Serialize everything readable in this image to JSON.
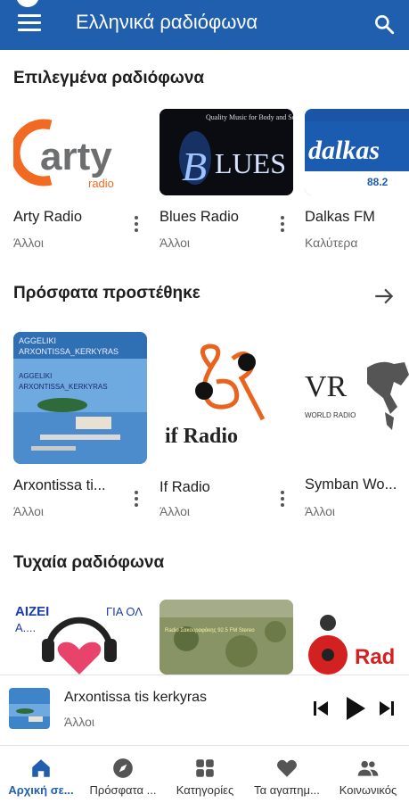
{
  "appbar": {
    "title": "Ελληνικά ραδιόφωνα"
  },
  "sections": {
    "featured": {
      "title": "Επιλεγμένα ραδιόφωνα",
      "items": [
        {
          "name": "Arty Radio",
          "category": "Άλλοι",
          "logo_text": "arty",
          "logo_sub": "radio"
        },
        {
          "name": "Blues Radio",
          "category": "Άλλοι",
          "logo_text": "BLUES",
          "logo_sub": "Quality Music for Body and Soul"
        },
        {
          "name": "Dalkas FM",
          "category": "Καλύτερα",
          "logo_text": "dalkas",
          "logo_sub": "88.2"
        }
      ]
    },
    "recent": {
      "title": "Πρόσφατα προστέθηκε",
      "items": [
        {
          "name": "Arxontissa ti...",
          "category": "Άλλοι",
          "logo_text": "AGGELIKI ARXONTISSA_KERKYRAS",
          "logo_sub": "AGGELIKI ARXONTISSA KERKYRAS"
        },
        {
          "name": "If Radio",
          "category": "Άλλοι",
          "logo_text": "if Radio",
          "logo_sub": "62"
        },
        {
          "name": "Symban Wo...",
          "category": "Άλλοι",
          "logo_text": "VR",
          "logo_sub": "WORLD RADIO"
        }
      ]
    },
    "random": {
      "title": "Τυχαία ραδιόφωνα",
      "items": [
        {
          "logo_text": "ΑΙΖΕΙ",
          "logo_sub": "ΓΙΑ ΟΛ"
        },
        {
          "logo_text": "Radio Σακουραφάκης 92.5 FM Stereo"
        },
        {
          "logo_text": "Rad"
        }
      ]
    }
  },
  "player": {
    "title": "Arxontissa tis kerkyras",
    "subtitle": "Άλλοι"
  },
  "nav": [
    {
      "label": "Αρχική σε...",
      "icon": "home-icon"
    },
    {
      "label": "Πρόσφατα ...",
      "icon": "compass-icon"
    },
    {
      "label": "Κατηγορίες",
      "icon": "grid-icon"
    },
    {
      "label": "Τα αγαπημ...",
      "icon": "heart-icon"
    },
    {
      "label": "Κοινωνικός",
      "icon": "people-icon"
    }
  ],
  "colors": {
    "primary": "#1f5fae",
    "text": "#1e1e1e",
    "secondary_text": "#6b6b6b"
  }
}
